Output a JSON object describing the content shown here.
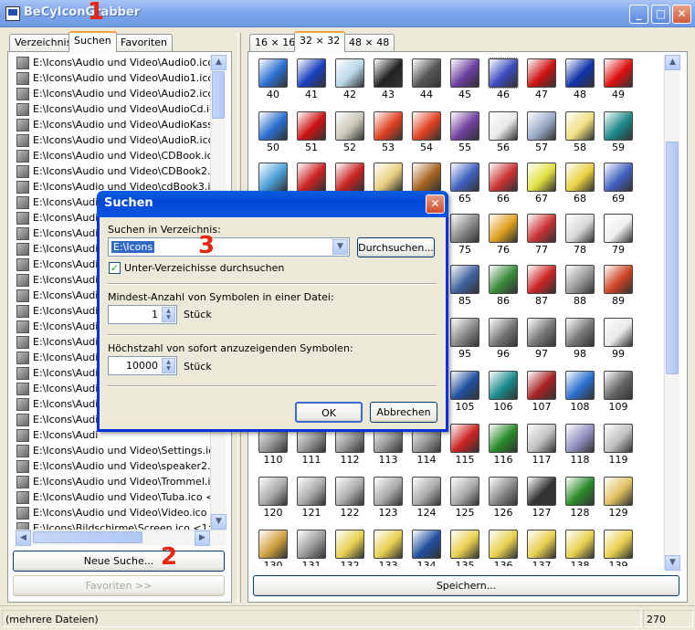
{
  "window": {
    "title": "BeCyIconGrabber",
    "minimize": "_",
    "maximize": "□",
    "close": "✕"
  },
  "markers": [
    "1",
    "2",
    "3"
  ],
  "left_tabs": [
    "Verzeichnis",
    "Suchen",
    "Favoriten"
  ],
  "right_tabs": [
    "16 × 16",
    "32 × 32",
    "48 × 48"
  ],
  "files": [
    "E:\\Icons\\Audio und Video\\Audio0.ico <1>",
    "E:\\Icons\\Audio und Video\\Audio1.ico <1>",
    "E:\\Icons\\Audio und Video\\Audio2.ico <1>",
    "E:\\Icons\\Audio und Video\\AudioCd.ico",
    "E:\\Icons\\Audio und Video\\AudioKassett",
    "E:\\Icons\\Audio und Video\\AudioR.ico <",
    "E:\\Icons\\Audio und Video\\CDBook.ico",
    "E:\\Icons\\Audio und Video\\CDBook2.ico",
    "E:\\Icons\\Audio und Video\\cdBook3.ico",
    "E:\\Icons\\Audi",
    "E:\\Icons\\Audi",
    "E:\\Icons\\Audi",
    "E:\\Icons\\Audi",
    "E:\\Icons\\Audi",
    "E:\\Icons\\Audi",
    "E:\\Icons\\Audi",
    "E:\\Icons\\Audi",
    "E:\\Icons\\Audi",
    "E:\\Icons\\Audi",
    "E:\\Icons\\Audi",
    "E:\\Icons\\Audi",
    "E:\\Icons\\Audi",
    "E:\\Icons\\Audi",
    "E:\\Icons\\Audi",
    "E:\\Icons\\Audi",
    "E:\\Icons\\Audio und Video\\Settings.ico",
    "E:\\Icons\\Audio und Video\\speaker2.ico",
    "E:\\Icons\\Audio und Video\\Trommel.ico",
    "E:\\Icons\\Audio und Video\\Tuba.ico <1>",
    "E:\\Icons\\Audio und Video\\Video.ico <1>",
    "E:\\Icons\\Bildschirme\\Screen.ico <1>",
    "E:\\Icons\\Bildschirme\\Screen10.ico <1"
  ],
  "buttons": {
    "new_search": "Neue Suche...",
    "favorites": "Favoriten >>",
    "save": "Speichern..."
  },
  "status": {
    "left": "(mehrere Dateien)",
    "count": "270"
  },
  "icons": [
    {
      "n": "40",
      "c": "#2a6fd0"
    },
    {
      "n": "41",
      "c": "#1a3fbf"
    },
    {
      "n": "42",
      "c": "#b7d7e8"
    },
    {
      "n": "43",
      "c": "#222222"
    },
    {
      "n": "44",
      "c": "#555555"
    },
    {
      "n": "45",
      "c": "#6b3fa0"
    },
    {
      "n": "46",
      "c": "#3b4bbd"
    },
    {
      "n": "47",
      "c": "#d01010"
    },
    {
      "n": "48",
      "c": "#1133aa"
    },
    {
      "n": "49",
      "c": "#e01010"
    },
    {
      "n": "50",
      "c": "#2a6fd0"
    },
    {
      "n": "51",
      "c": "#cc1111"
    },
    {
      "n": "52",
      "c": "#c9c7b8"
    },
    {
      "n": "53",
      "c": "#e04020"
    },
    {
      "n": "54",
      "c": "#e04020"
    },
    {
      "n": "55",
      "c": "#7040a0"
    },
    {
      "n": "56",
      "c": "#e8e8e8"
    },
    {
      "n": "57",
      "c": "#9aa9c8"
    },
    {
      "n": "58",
      "c": "#f0e080"
    },
    {
      "n": "59",
      "c": "#1a8888"
    },
    {
      "n": "60",
      "c": "#4aa0d8"
    },
    {
      "n": "61",
      "c": "#cc2222"
    },
    {
      "n": "62",
      "c": "#cc2222"
    },
    {
      "n": "63",
      "c": "#e8d080"
    },
    {
      "n": "64",
      "c": "#aa6622"
    },
    {
      "n": "65",
      "c": "#4060c0"
    },
    {
      "n": "66",
      "c": "#cc3333"
    },
    {
      "n": "67",
      "c": "#e0e040"
    },
    {
      "n": "68",
      "c": "#e8d040"
    },
    {
      "n": "69",
      "c": "#4060c0"
    },
    {
      "n": "75",
      "c": "#888888"
    },
    {
      "n": "76",
      "c": "#e0a020"
    },
    {
      "n": "77",
      "c": "#cc3333"
    },
    {
      "n": "78",
      "c": "#d8d8d8"
    },
    {
      "n": "79",
      "c": "#f0f0f0"
    },
    {
      "n": "85",
      "c": "#4060a0"
    },
    {
      "n": "86",
      "c": "#3a8a3a"
    },
    {
      "n": "87",
      "c": "#cc2222"
    },
    {
      "n": "88",
      "c": "#999999"
    },
    {
      "n": "89",
      "c": "#cc4422"
    },
    {
      "n": "95",
      "c": "#888888"
    },
    {
      "n": "96",
      "c": "#777777"
    },
    {
      "n": "97",
      "c": "#777777"
    },
    {
      "n": "98",
      "c": "#777777"
    },
    {
      "n": "99",
      "c": "#e8e8e8"
    },
    {
      "n": "105",
      "c": "#2050a0"
    },
    {
      "n": "106",
      "c": "#1a8a8a"
    },
    {
      "n": "107",
      "c": "#aa2222"
    },
    {
      "n": "108",
      "c": "#2a6fd0"
    },
    {
      "n": "109",
      "c": "#666666"
    },
    {
      "n": "110",
      "c": "#999999"
    },
    {
      "n": "111",
      "c": "#999999"
    },
    {
      "n": "112",
      "c": "#999999"
    },
    {
      "n": "113",
      "c": "#999999"
    },
    {
      "n": "114",
      "c": "#999999"
    },
    {
      "n": "115",
      "c": "#cc2222"
    },
    {
      "n": "116",
      "c": "#2a8a2a"
    },
    {
      "n": "117",
      "c": "#c0c0c0"
    },
    {
      "n": "118",
      "c": "#9090c0"
    },
    {
      "n": "119",
      "c": "#c0c0c0"
    },
    {
      "n": "120",
      "c": "#aaaaaa"
    },
    {
      "n": "121",
      "c": "#aaaaaa"
    },
    {
      "n": "122",
      "c": "#aaaaaa"
    },
    {
      "n": "123",
      "c": "#aaaaaa"
    },
    {
      "n": "124",
      "c": "#aaaaaa"
    },
    {
      "n": "125",
      "c": "#aaaaaa"
    },
    {
      "n": "126",
      "c": "#888888"
    },
    {
      "n": "127",
      "c": "#333333"
    },
    {
      "n": "128",
      "c": "#2a8a2a"
    },
    {
      "n": "129",
      "c": "#e0c060"
    },
    {
      "n": "130",
      "c": "#d0a040"
    },
    {
      "n": "131",
      "c": "#999999"
    },
    {
      "n": "132",
      "c": "#e8d050"
    },
    {
      "n": "133",
      "c": "#e8d050"
    },
    {
      "n": "134",
      "c": "#2050a0"
    },
    {
      "n": "135",
      "c": "#e8d050"
    },
    {
      "n": "136",
      "c": "#e8d050"
    },
    {
      "n": "137",
      "c": "#e8d050"
    },
    {
      "n": "138",
      "c": "#e8d050"
    },
    {
      "n": "139",
      "c": "#e8d050"
    }
  ],
  "dialog": {
    "title": "Suchen",
    "close": "✕",
    "dir_label": "Suchen in Verzeichnis:",
    "dir_value": "E:\\Icons",
    "browse": "Durchsuchen...",
    "subdirs_label": "Unter-Verzeichisse durchsuchen",
    "min_label": "Mindest-Anzahl von Symbolen in einer Datei:",
    "min_value": "1",
    "unit1": "Stück",
    "max_label": "Höchstzahl von sofort anzuzeigenden Symbolen:",
    "max_value": "10000",
    "unit2": "Stück",
    "ok": "OK",
    "cancel": "Abbrechen"
  }
}
